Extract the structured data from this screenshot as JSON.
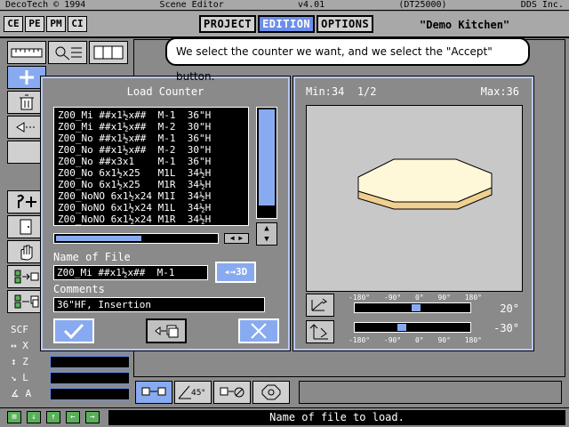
{
  "titlebar": {
    "left": "DecoTech © 1994",
    "center": "Scene Editor",
    "version": "v4.01",
    "build": "(DT25000)",
    "right": "DDS Inc."
  },
  "modes": [
    "CE",
    "PE",
    "PM",
    "CI"
  ],
  "tabs": [
    {
      "label": "PROJECT",
      "active": false
    },
    {
      "label": "EDITION",
      "active": true
    },
    {
      "label": "OPTIONS",
      "active": false
    }
  ],
  "project_name": "\"Demo Kitchen\"",
  "callout": "We select the counter we want, and we select the \"Accept\" button.",
  "dialog": {
    "title": "Load Counter",
    "rows": [
      "Z00_Mi ##x1½x##  M-1  36\"H",
      "Z00_Mi ##x1½x##  M-2  30\"H",
      "Z00_No ##x1½x##  M-1  36\"H",
      "Z00_No ##x1½x##  M-2  30\"H",
      "Z00_No ##x3x1    M-1  36\"H",
      "Z00_No 6x1½x25   M1L  34½H",
      "Z00_No 6x1½x25   M1R  34½H",
      "Z00_NoNO 6x1½x24 M1I  34½H",
      "Z00_NoNO 6x1½x24 M1L  34½H",
      "Z00_NoNO 6x1½x24 M1R  34½H"
    ],
    "name_label": "Name of File",
    "name_value": "Z00_Mi ##x1½x##  M-1",
    "btn_3d": "3D",
    "comments_label": "Comments",
    "comments_value": "36\"HF, Insertion"
  },
  "preview": {
    "min": "Min:34",
    "page": "1/2",
    "max": "Max:36",
    "ticks": [
      "-180°",
      "-90°",
      "0°",
      "90°",
      "180°"
    ],
    "angle1": "20°",
    "angle2": "-30°"
  },
  "scale": {
    "title": "SCF",
    "labels": [
      "X",
      "Z",
      "L",
      "A"
    ]
  },
  "status": "Name of file to load.",
  "colors": {
    "accent": "#6c8ee8",
    "dialog_border": "#b8c8f8",
    "counter_top": "#fff8d8",
    "status_green": "#5ab05a"
  }
}
